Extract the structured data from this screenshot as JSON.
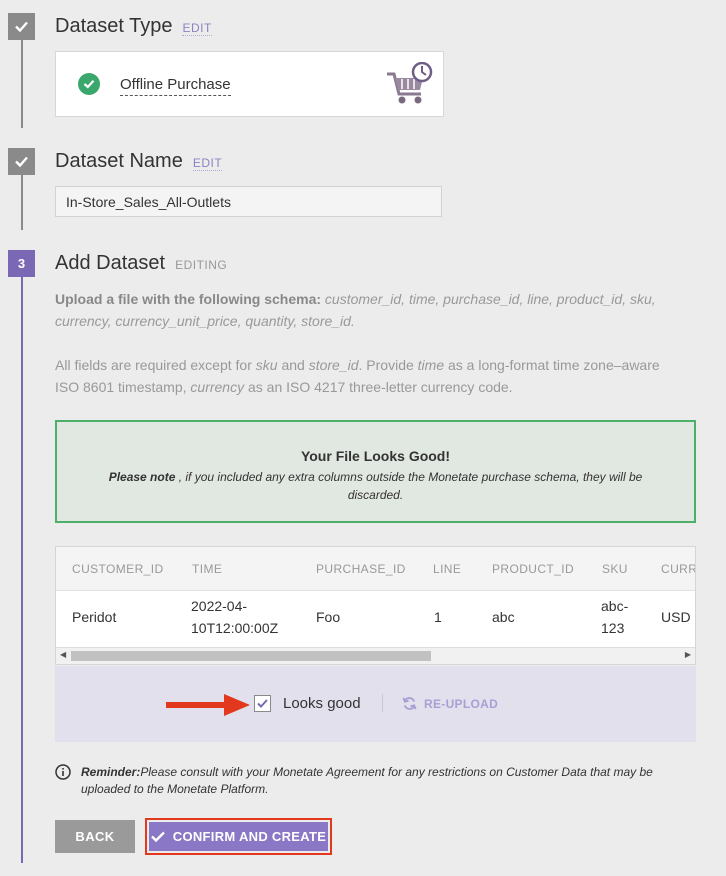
{
  "steps": [
    {
      "title": "Dataset Type",
      "action": "EDIT"
    },
    {
      "title": "Dataset Name",
      "action": "EDIT"
    },
    {
      "number": "3",
      "title": "Add Dataset",
      "status": "EDITING"
    }
  ],
  "dataset_type": {
    "label": "Offline Purchase"
  },
  "dataset_name": {
    "value": "In-Store_Sales_All-Outlets"
  },
  "schema": {
    "lead": "Upload a file with the following schema:",
    "fields": "customer_id, time, purchase_id, line, product_id, sku, currency, currency_unit_price, quantity, store_id.",
    "req_1": "All fields are required except for ",
    "req_sku": "sku",
    "req_and": " and ",
    "req_store": "store_id",
    "req_2": ". Provide ",
    "req_time": "time",
    "req_3": " as a long-format time zone–aware ISO 8601 timestamp, ",
    "req_currency": "currency",
    "req_4": " as an ISO 4217 three-letter currency code."
  },
  "success": {
    "title": "Your File Looks Good!",
    "note_bold": "Please note",
    "note_text": " , if you included any extra columns outside the Monetate purchase schema, they will be discarded."
  },
  "table": {
    "headers": [
      "CUSTOMER_ID",
      "TIME",
      "PURCHASE_ID",
      "LINE",
      "PRODUCT_ID",
      "SKU",
      "CURR"
    ],
    "row": {
      "customer_id": "Peridot",
      "time_1": "2022-04-",
      "time_2": "10T12:00:00Z",
      "purchase_id": "Foo",
      "line": "1",
      "product_id": "abc",
      "sku_1": "abc-",
      "sku_2": "123",
      "currency": "USD"
    }
  },
  "confirm": {
    "checkbox_label": "Looks good",
    "checked": true,
    "reupload_label": "RE-UPLOAD"
  },
  "reminder": {
    "bold": "Reminder:",
    "text": "Please consult with your Monetate Agreement for any restrictions on Customer Data that may be uploaded to the Monetate Platform."
  },
  "buttons": {
    "back": "BACK",
    "confirm": "CONFIRM AND CREATE"
  },
  "colors": {
    "accent": "#7b68b5",
    "success": "#3aa76d",
    "highlight": "#e2381e"
  }
}
